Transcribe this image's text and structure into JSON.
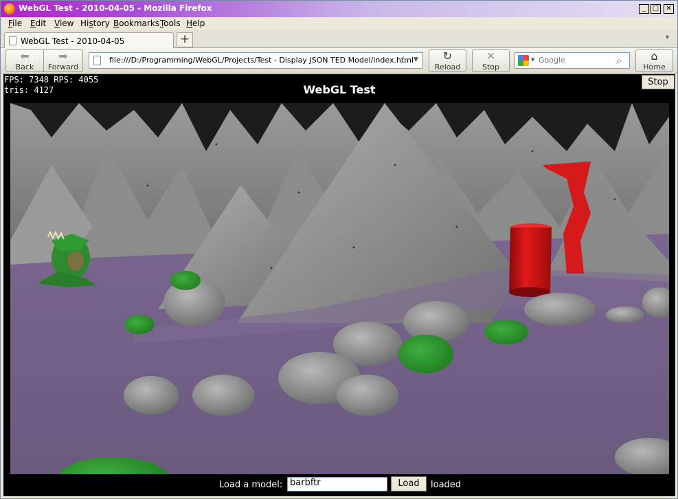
{
  "window": {
    "title": "WebGL Test - 2010-04-05 - Mozilla Firefox",
    "min": "_",
    "max": "□",
    "close": "✕"
  },
  "menu": [
    {
      "key": "F",
      "rest": "ile"
    },
    {
      "key": "E",
      "rest": "dit"
    },
    {
      "key": "V",
      "rest": "iew"
    },
    {
      "key": "H",
      "rest": "istory",
      "prefix": "Hi",
      "suffix": "story"
    },
    {
      "key": "B",
      "rest": "ookmarks"
    },
    {
      "key": "T",
      "rest": "ools"
    },
    {
      "key": "H",
      "rest": "elp"
    }
  ],
  "tab": {
    "title": "WebGL Test - 2010-04-05",
    "new": "+",
    "list": "▾"
  },
  "nav": {
    "back": "Back",
    "forward": "Forward",
    "url": "file:///D:/Programming/WebGL/Projects/Test - Display JSON TED Model/index.html",
    "reload": "Reload",
    "stop": "Stop",
    "search_placeholder": "Google",
    "home": "Home"
  },
  "page": {
    "stats_line1": "FPS: 7348 RPS: 4055",
    "stats_line2": "tris: 4127",
    "title": "WebGL Test",
    "stop_button": "Stop",
    "load_label": "Load a model:",
    "model_value": "barbftr",
    "load_button": "Load",
    "status": "loaded"
  },
  "scene_colors": {
    "sky": "#1a1a1a",
    "rock": "#8a8a8a",
    "water": "#6e5a80",
    "dragon": "#2f8a2f",
    "barrel": "#d01818"
  }
}
